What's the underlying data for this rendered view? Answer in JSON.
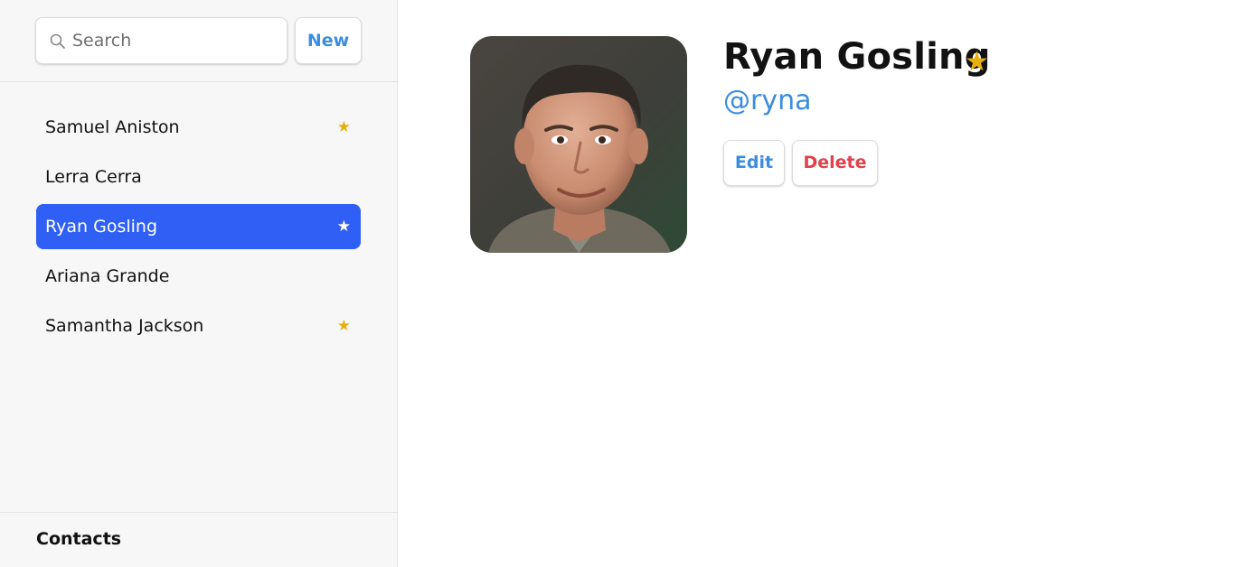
{
  "sidebar": {
    "search": {
      "placeholder": "Search",
      "icon": "search-icon"
    },
    "new_button": "New",
    "contacts": [
      {
        "name": "Samuel Aniston",
        "favorite": true,
        "star": "★"
      },
      {
        "name": "Lerra Cerra",
        "favorite": false,
        "star": ""
      },
      {
        "name": "Ryan Gosling",
        "favorite": true,
        "star": "★",
        "selected": true
      },
      {
        "name": "Ariana Grande",
        "favorite": false,
        "star": ""
      },
      {
        "name": "Samantha Jackson",
        "favorite": true,
        "star": "★"
      }
    ],
    "footer": "Contacts"
  },
  "detail": {
    "name": "Ryan Gosling",
    "favorite_star": "★",
    "handle": "@ryna",
    "edit_button": "Edit",
    "delete_button": "Delete"
  },
  "colors": {
    "accent": "#3a8de0",
    "selection": "#2f5ff5",
    "star": "#e8b00c",
    "danger": "#e0414b"
  }
}
